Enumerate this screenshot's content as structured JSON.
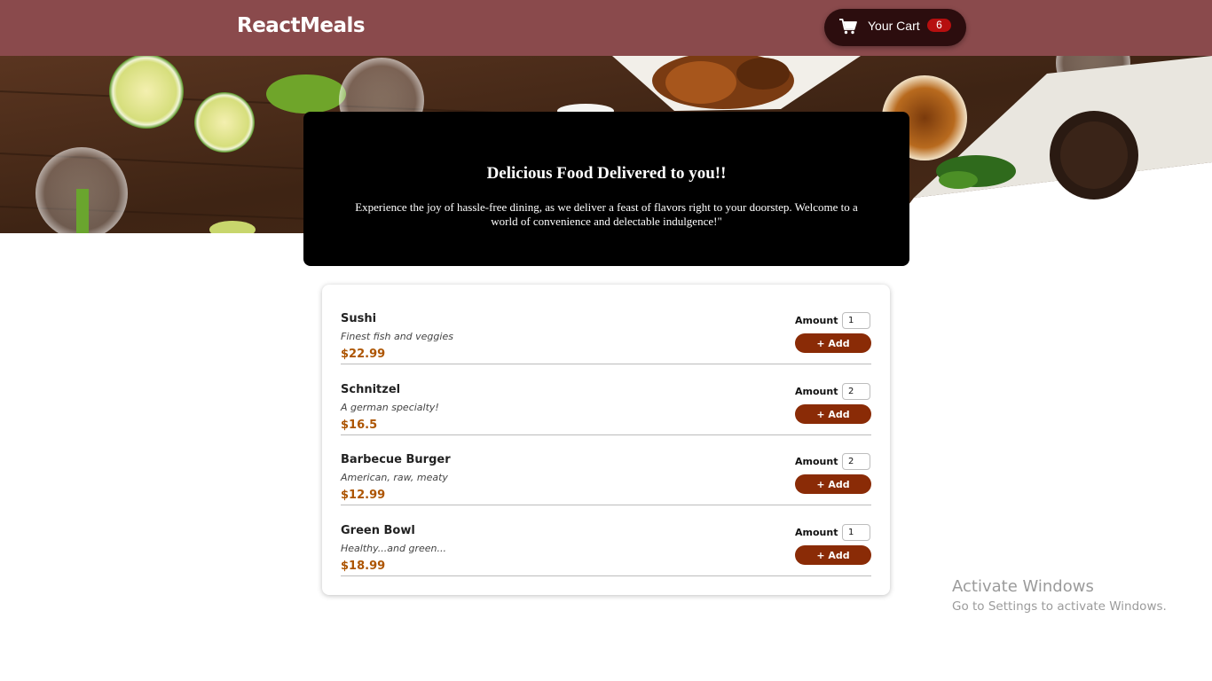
{
  "header": {
    "brand": "ReactMeals",
    "cart": {
      "label": "Your Cart",
      "count": "6",
      "icon": "cart-icon"
    }
  },
  "summary": {
    "title": "Delicious Food Delivered to you!!",
    "text": "Experience the joy of hassle-free dining, as we deliver a feast of flavors right to your doorstep. Welcome to a world of convenience and delectable indulgence!\""
  },
  "meals": [
    {
      "name": "Sushi",
      "description": "Finest fish and veggies",
      "price": "$22.99",
      "amount_label": "Amount",
      "amount": "1",
      "add_label": "+ Add"
    },
    {
      "name": "Schnitzel",
      "description": "A german specialty!",
      "price": "$16.5",
      "amount_label": "Amount",
      "amount": "2",
      "add_label": "+ Add"
    },
    {
      "name": "Barbecue Burger",
      "description": "American, raw, meaty",
      "price": "$12.99",
      "amount_label": "Amount",
      "amount": "2",
      "add_label": "+ Add"
    },
    {
      "name": "Green Bowl",
      "description": "Healthy...and green...",
      "price": "$18.99",
      "amount_label": "Amount",
      "amount": "1",
      "add_label": "+ Add"
    }
  ],
  "watermark": {
    "title": "Activate Windows",
    "subtitle": "Go to Settings to activate Windows."
  },
  "colors": {
    "header": "#8a4a4c",
    "cart_button": "#2c0d0e",
    "badge": "#b60f0f",
    "add_button": "#8a2b06",
    "price": "#ad5502"
  }
}
